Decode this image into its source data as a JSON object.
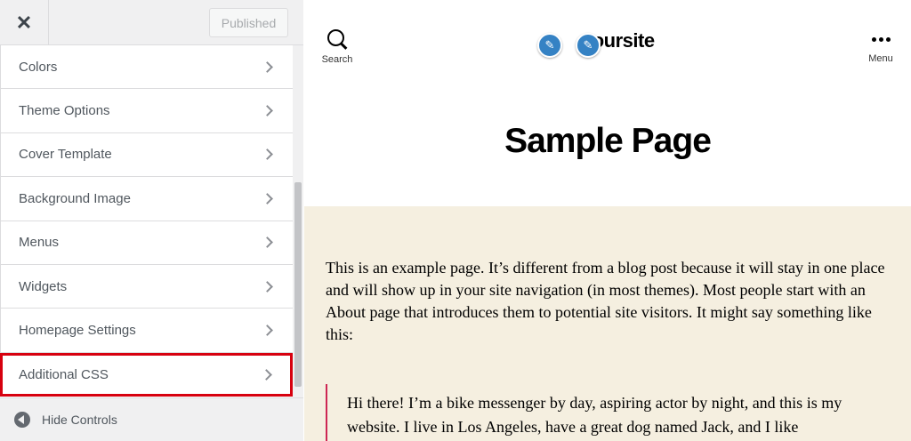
{
  "header": {
    "close_glyph": "✕",
    "published_label": "Published"
  },
  "sidebar": {
    "items": [
      {
        "label": "Colors"
      },
      {
        "label": "Theme Options"
      },
      {
        "label": "Cover Template"
      },
      {
        "label": "Background Image"
      },
      {
        "label": "Menus"
      },
      {
        "label": "Widgets"
      },
      {
        "label": "Homepage Settings"
      },
      {
        "label": "Additional CSS",
        "highlighted": true
      }
    ],
    "footer_label": "Hide Controls"
  },
  "preview": {
    "search_label": "Search",
    "menu_label": "Menu",
    "site_title": "yoursite",
    "page_title": "Sample Page",
    "paragraph": "This is an example page. It’s different from a blog post because it will stay in one place and will show up in your site navigation (in most themes). Most people start with an About page that introduces them to potential site visitors. It might say something like this:",
    "quote": "Hi there! I’m a bike messenger by day, aspiring actor by night, and this is my website. I live in Los Angeles, have a great dog named Jack, and I like"
  },
  "icons": {
    "close": "close-icon",
    "chevron": "chevron-right-icon",
    "hide": "arrow-left-circle-icon",
    "search": "search-icon",
    "menu": "more-dots-icon",
    "edit": "pencil-icon"
  },
  "colors": {
    "highlight_border": "#d7000f",
    "edit_badge": "#3582c4",
    "content_background": "#f5efe0",
    "quote_border": "#cd2653"
  }
}
